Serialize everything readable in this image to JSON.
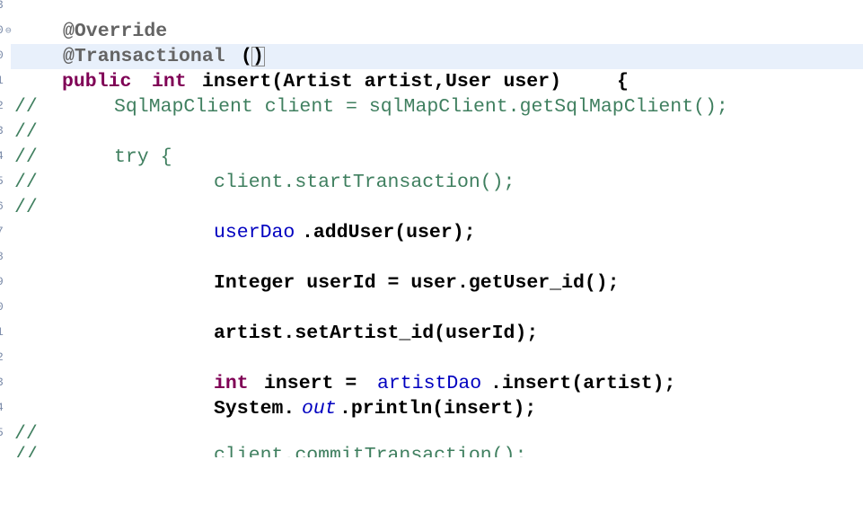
{
  "gutter_fragments": [
    "3",
    "0",
    "0",
    "1",
    "2",
    "3",
    "4",
    "5",
    "6",
    "7",
    "8",
    "9",
    "0",
    "1",
    "2",
    "3",
    "4",
    "5"
  ],
  "code": {
    "line_1": {
      "text": "@Override"
    },
    "line_2": {
      "text_a": "@Transactional",
      "text_b": "(",
      "text_c": ")"
    },
    "line_3": {
      "kw1": "public",
      "kw2": "int",
      "rest": "insert(Artist artist,User user)",
      "brace": "{"
    },
    "line_4": {
      "comment": "//",
      "code": "SqlMapClient client = sqlMapClient.getSqlMapClient();"
    },
    "line_5": {
      "comment": "//"
    },
    "line_6": {
      "comment": "//",
      "code": "try {"
    },
    "line_7": {
      "comment": "//",
      "code": "client.startTransaction();"
    },
    "line_8": {
      "comment": "//"
    },
    "line_9": {
      "field": "userDao",
      "rest": ".addUser(user);"
    },
    "line_10": {
      "text": "Integer userId = user.getUser_id();"
    },
    "line_11": {
      "text": "artist.setArtist_id(userId);"
    },
    "line_12": {
      "kw": "int",
      "mid": "insert = ",
      "field": "artistDao",
      "rest": ".insert(artist);"
    },
    "line_13": {
      "a": "System.",
      "stat": "out",
      "b": ".println(insert);"
    },
    "line_14": {
      "comment": "//"
    },
    "line_15": {
      "comment": "//",
      "code": "client.commitTransaction();"
    }
  }
}
